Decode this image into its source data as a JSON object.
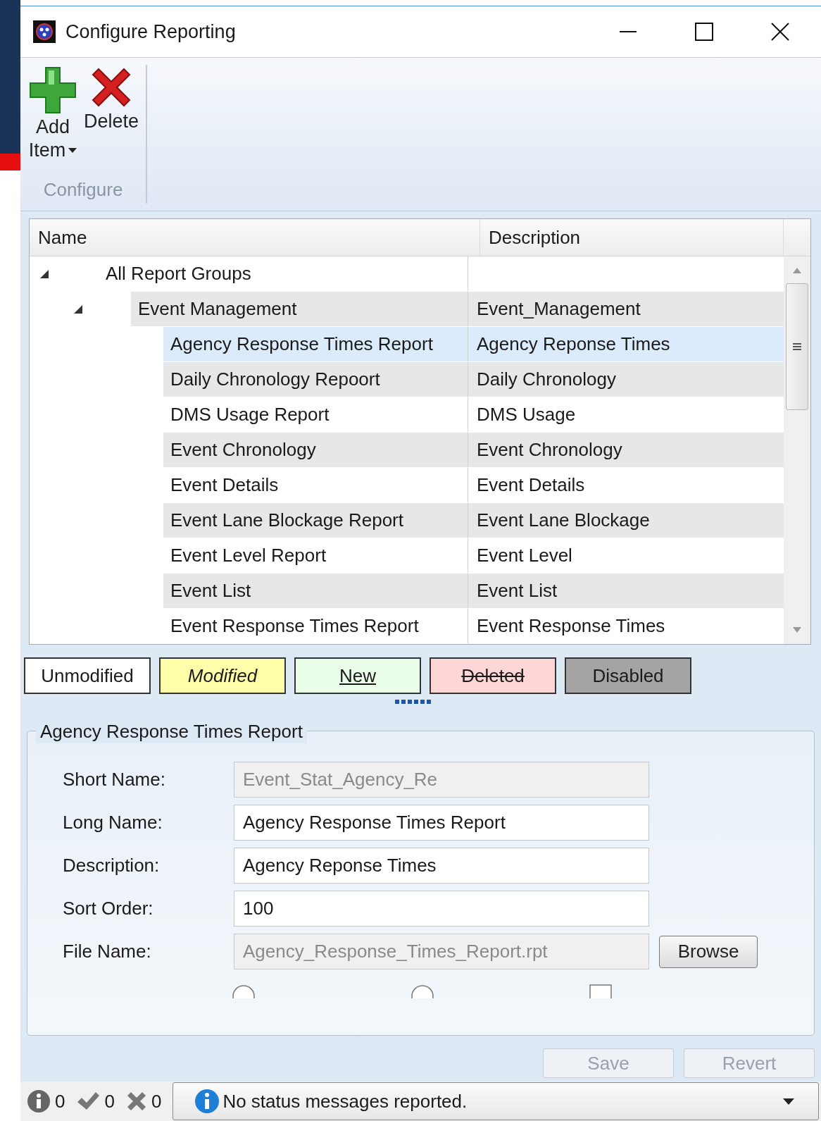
{
  "window": {
    "title": "Configure Reporting"
  },
  "ribbon": {
    "buttons": [
      {
        "kind": "add",
        "label": "Add",
        "label2": "Item",
        "dropdown": true
      },
      {
        "kind": "delete",
        "label": "Delete"
      }
    ],
    "group_label": "Configure"
  },
  "tree": {
    "columns": [
      "Name",
      "Description"
    ],
    "rows": [
      {
        "name": "All Report Groups",
        "expanded": true,
        "selected": false,
        "children": [
          {
            "name": "Event Management",
            "description": "Event_Management",
            "expanded": true,
            "selected": false,
            "children": [
              {
                "name": "Agency Response Times Report",
                "description": "Agency Reponse Times",
                "selected": true
              },
              {
                "name": "Daily Chronology Repoort",
                "description": "Daily Chronology",
                "selected": false
              },
              {
                "name": "DMS Usage Report",
                "description": "DMS Usage",
                "selected": false
              },
              {
                "name": "Event Chronology",
                "description": "Event Chronology",
                "selected": false
              },
              {
                "name": "Event Details",
                "description": "Event Details",
                "selected": false
              },
              {
                "name": "Event Lane Blockage Report",
                "description": "Event Lane Blockage",
                "selected": false
              },
              {
                "name": "Event Level Report",
                "description": "Event Level",
                "selected": false
              },
              {
                "name": "Event List",
                "description": "Event List",
                "selected": false
              },
              {
                "name": "Event Response Times Report",
                "description": "Event Response Times",
                "selected": false
              }
            ]
          }
        ]
      }
    ]
  },
  "legend": [
    {
      "kind": "unmodified",
      "label": "Unmodified"
    },
    {
      "kind": "modified",
      "label": "Modified"
    },
    {
      "kind": "new",
      "label": "New"
    },
    {
      "kind": "deleted",
      "label": "Deleted"
    },
    {
      "kind": "disabled",
      "label": "Disabled"
    }
  ],
  "details": {
    "title": "Agency Response Times Report",
    "fields": [
      {
        "label": "Short Name:",
        "value": "Event_Stat_Agency_Re",
        "readonly": true
      },
      {
        "label": "Long Name:",
        "value": "Agency Response Times Report",
        "readonly": false
      },
      {
        "label": "Description:",
        "value": "Agency Reponse Times",
        "readonly": false
      },
      {
        "label": "Sort Order:",
        "value": "100",
        "readonly": false
      },
      {
        "label": "File Name:",
        "value": "Agency_Response_Times_Report.rpt",
        "readonly": true,
        "button": "Browse"
      }
    ]
  },
  "actions": [
    {
      "label": "Save",
      "disabled": true
    },
    {
      "label": "Revert",
      "disabled": true
    }
  ],
  "status_bar": {
    "counts": [
      {
        "kind": "info",
        "count": "0"
      },
      {
        "kind": "success",
        "count": "0"
      },
      {
        "kind": "error",
        "count": "0"
      }
    ],
    "message": "No status messages reported."
  }
}
